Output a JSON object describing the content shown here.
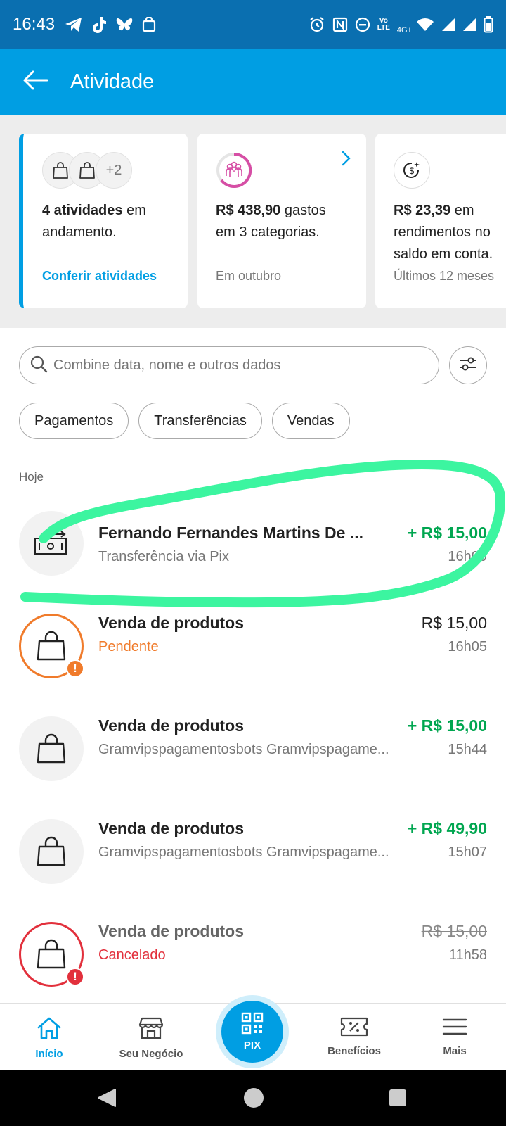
{
  "status_bar": {
    "time": "16:43",
    "left_icons": [
      "telegram-icon",
      "tiktok-icon",
      "bluesky-icon",
      "shopping-bag-icon"
    ],
    "right_icons": [
      "alarm-icon",
      "nfc-icon",
      "do-not-disturb-icon",
      "volte-icon",
      "wifi-icon",
      "signal-icon",
      "signal-icon",
      "battery-icon"
    ],
    "volte_text": "Vo\nLTE",
    "network": "4G+"
  },
  "app_bar": {
    "title": "Atividade",
    "back_icon": "arrow-left-icon"
  },
  "summary_cards": [
    {
      "avatars_extra": "+2",
      "text_bold": "4 atividades",
      "text_rest": " em andamento.",
      "link": "Conferir atividades"
    },
    {
      "text_bold": "R$ 438,90",
      "text_rest": " gastos em 3 categorias.",
      "footer": "Em outubro"
    },
    {
      "text_bold": "R$ 23,39",
      "text_rest": " em rendimentos no saldo em conta.",
      "footer": "Últimos 12 meses"
    }
  ],
  "search": {
    "placeholder": "Combine data, nome e outros dados"
  },
  "chips": [
    "Pagamentos",
    "Transferências",
    "Vendas"
  ],
  "section_label": "Hoje",
  "transactions": [
    {
      "title": "Fernando Fernandes Martins De ...",
      "subtitle": "Transferência via Pix",
      "amount": "+ R$ 15,00",
      "time": "16h09",
      "icon": "money-transfer-icon"
    },
    {
      "title": "Venda de produtos",
      "subtitle": "Pendente",
      "amount": "R$ 15,00",
      "time": "16h05",
      "icon": "shopping-bag-icon",
      "badge": "!"
    },
    {
      "title": "Venda de produtos",
      "subtitle": "Gramvipspagamentosbots Gramvipspagame...",
      "amount": "+ R$ 15,00",
      "time": "15h44",
      "icon": "shopping-bag-icon"
    },
    {
      "title": "Venda de produtos",
      "subtitle": "Gramvipspagamentosbots Gramvipspagame...",
      "amount": "+ R$ 49,90",
      "time": "15h07",
      "icon": "shopping-bag-icon"
    },
    {
      "title": "Venda de produtos",
      "subtitle": "Cancelado",
      "amount": "R$ 15,00",
      "time": "11h58",
      "icon": "shopping-bag-icon",
      "badge": "!"
    }
  ],
  "bottom_nav": {
    "items": [
      {
        "label": "Início",
        "icon": "home-icon"
      },
      {
        "label": "Seu Negócio",
        "icon": "store-icon"
      },
      {
        "label": "PIX",
        "icon": "qr-code-icon"
      },
      {
        "label": "Benefícios",
        "icon": "discount-ticket-icon"
      },
      {
        "label": "Mais",
        "icon": "menu-icon"
      }
    ]
  },
  "colors": {
    "brand": "#009ee3",
    "status_bar": "#0a6fb0",
    "positive": "#00a650",
    "pending": "#f07b2b",
    "cancelled": "#e2303c",
    "highlight": "#3cf5a0"
  }
}
